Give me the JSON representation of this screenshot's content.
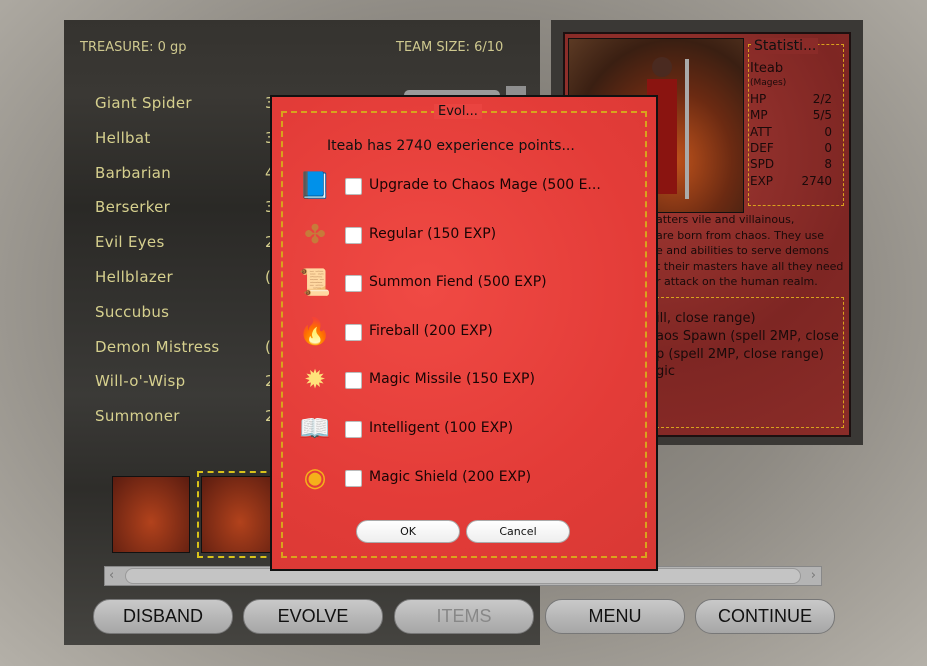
{
  "header": {
    "treasure": "TREASURE: 0 gp",
    "team_size": "TEAM SIZE: 6/10"
  },
  "units": [
    {
      "name": "Giant Spider",
      "partial": "3"
    },
    {
      "name": "Hellbat",
      "partial": "3"
    },
    {
      "name": "Barbarian",
      "partial": "4"
    },
    {
      "name": "Berserker",
      "partial": "3"
    },
    {
      "name": "Evil Eyes",
      "partial": "2"
    },
    {
      "name": "Hellblazer",
      "partial": "("
    },
    {
      "name": "Succubus",
      "partial": ""
    },
    {
      "name": "Demon Mistress",
      "partial": "("
    },
    {
      "name": "Will-o'-Wisp",
      "partial": "2"
    },
    {
      "name": "Summoner",
      "partial": "2"
    }
  ],
  "stats": {
    "title": "Statisti...",
    "name": "Iteab",
    "class": "(Mages)",
    "rows": [
      {
        "k": "HP",
        "v": "2/2"
      },
      {
        "k": "MP",
        "v": "5/5"
      },
      {
        "k": "ATT",
        "v": "0"
      },
      {
        "k": "DEF",
        "v": "0"
      },
      {
        "k": "SPD",
        "v": "8"
      },
      {
        "k": "EXP",
        "v": "2740"
      }
    ]
  },
  "description": [
    "atters vile and villainous,",
    "are born from chaos. They use",
    "e and abilities to serve demons",
    "t their masters have all they need",
    "r attack on the human realm."
  ],
  "abilities": [
    "ill, close range)",
    "aos Spawn (spell 2MP, close",
    "p (spell 2MP, close range)",
    "gic"
  ],
  "dialog": {
    "title": "Evol...",
    "message": "Iteab has 2740 experience points...",
    "options": [
      {
        "label": "Upgrade to Chaos Mage (500 E...",
        "icon": "upgrade-book-icon",
        "checked": false
      },
      {
        "label": "Regular (150 EXP)",
        "icon": "cross-emblem-icon",
        "checked": false
      },
      {
        "label": "Summon Fiend (500 EXP)",
        "icon": "scroll-icon",
        "checked": false
      },
      {
        "label": "Fireball (200 EXP)",
        "icon": "fire-icon",
        "checked": false
      },
      {
        "label": "Magic Missile (150 EXP)",
        "icon": "star-burst-icon",
        "checked": false
      },
      {
        "label": "Intelligent (100 EXP)",
        "icon": "open-book-icon",
        "checked": false
      },
      {
        "label": "Magic Shield (200 EXP)",
        "icon": "shield-orb-icon",
        "checked": false
      }
    ],
    "ok": "OK",
    "cancel": "Cancel"
  },
  "buttons": {
    "disband": "DISBAND",
    "evolve": "EVOLVE",
    "items": "ITEMS",
    "menu": "MENU",
    "continue": "CONTINUE"
  },
  "scroll": {
    "left": "‹",
    "right": "›"
  }
}
